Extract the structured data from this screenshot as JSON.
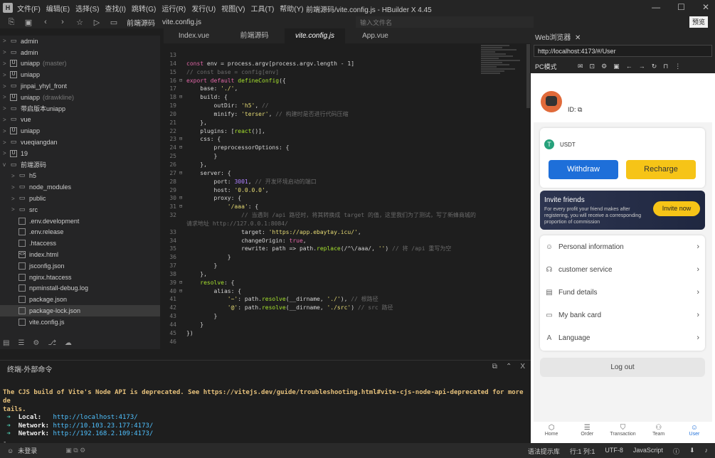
{
  "window": {
    "title": "前端源码/vite.config.js - HBuilder X 4.45",
    "menu": [
      "文件(F)",
      "编辑(E)",
      "选择(S)",
      "查找(I)",
      "跳转(G)",
      "运行(R)",
      "发行(U)",
      "视图(V)",
      "工具(T)",
      "帮助(Y)"
    ],
    "controls": [
      "—",
      "☐",
      "✕"
    ]
  },
  "toolbar": {
    "crumb1": "前端源码",
    "crumb2": "vite.config.js",
    "search_placeholder": "输入文件名",
    "preview_label": "预览"
  },
  "tree": [
    {
      "arrow": ">",
      "icon": "folder",
      "label": "admin",
      "branch": "",
      "indent": 0
    },
    {
      "arrow": ">",
      "icon": "folder",
      "label": "admin",
      "branch": "",
      "indent": 0
    },
    {
      "arrow": ">",
      "icon": "U",
      "label": "uniapp",
      "branch": "(master)",
      "indent": 0
    },
    {
      "arrow": ">",
      "icon": "U",
      "label": "uniapp",
      "branch": "",
      "indent": 0
    },
    {
      "arrow": ">",
      "icon": "folder",
      "label": "jinpai_yhyl_front",
      "branch": "",
      "indent": 0
    },
    {
      "arrow": ">",
      "icon": "U",
      "label": "uniapp",
      "branch": "(drawkline)",
      "indent": 0
    },
    {
      "arrow": ">",
      "icon": "folder",
      "label": "带启版本uniapp",
      "branch": "",
      "indent": 0
    },
    {
      "arrow": ">",
      "icon": "folder",
      "label": "vue",
      "branch": "",
      "indent": 0
    },
    {
      "arrow": ">",
      "icon": "U",
      "label": "uniapp",
      "branch": "",
      "indent": 0
    },
    {
      "arrow": ">",
      "icon": "folder",
      "label": "vueqiangdan",
      "branch": "",
      "indent": 0
    },
    {
      "arrow": ">",
      "icon": "U",
      "label": "19",
      "branch": "",
      "indent": 0
    },
    {
      "arrow": "v",
      "icon": "folder",
      "label": "前端源码",
      "branch": "",
      "indent": 0
    },
    {
      "arrow": ">",
      "icon": "folder",
      "label": "h5",
      "branch": "",
      "indent": 1
    },
    {
      "arrow": ">",
      "icon": "folder",
      "label": "node_modules",
      "branch": "",
      "indent": 1
    },
    {
      "arrow": ">",
      "icon": "folder",
      "label": "public",
      "branch": "",
      "indent": 1
    },
    {
      "arrow": ">",
      "icon": "folder",
      "label": "src",
      "branch": "",
      "indent": 1
    },
    {
      "arrow": "",
      "icon": "file",
      "label": ".env.development",
      "branch": "",
      "indent": 1
    },
    {
      "arrow": "",
      "icon": "file",
      "label": ".env.release",
      "branch": "",
      "indent": 1
    },
    {
      "arrow": "",
      "icon": "file",
      "label": ".htaccess",
      "branch": "",
      "indent": 1
    },
    {
      "arrow": "",
      "icon": "<>",
      "label": "index.html",
      "branch": "",
      "indent": 1
    },
    {
      "arrow": "",
      "icon": "file",
      "label": "jsconfig.json",
      "branch": "",
      "indent": 1
    },
    {
      "arrow": "",
      "icon": "file",
      "label": "nginx.htaccess",
      "branch": "",
      "indent": 1
    },
    {
      "arrow": "",
      "icon": "file",
      "label": "npminstall-debug.log",
      "branch": "",
      "indent": 1
    },
    {
      "arrow": "",
      "icon": "file",
      "label": "package.json",
      "branch": "",
      "indent": 1
    },
    {
      "arrow": "",
      "icon": "file",
      "label": "package-lock.json",
      "branch": "",
      "indent": 1,
      "selected": true
    },
    {
      "arrow": "",
      "icon": "file",
      "label": "vite.config.js",
      "branch": "",
      "indent": 1
    }
  ],
  "tabs": [
    "Index.vue",
    "前端源码",
    "vite.config.js",
    "App.vue"
  ],
  "code": [
    [
      "13",
      ""
    ],
    [
      "14",
      "const env = process.argv[process.argv.length - 1]"
    ],
    [
      "15",
      "// const base = config[env]"
    ],
    [
      "16",
      "export default defineConfig({"
    ],
    [
      "17",
      "    base: './',"
    ],
    [
      "18",
      "    build: {"
    ],
    [
      "19",
      "        outDir: 'h5', //"
    ],
    [
      "20",
      "        minify: 'terser', // 构建时是否进行代码压缩"
    ],
    [
      "21",
      "    },"
    ],
    [
      "22",
      "    plugins: [react()],"
    ],
    [
      "23",
      "    css: {"
    ],
    [
      "24",
      "        preprocessorOptions: {"
    ],
    [
      "25",
      "        }"
    ],
    [
      "26",
      "    },"
    ],
    [
      "27",
      "    server: {"
    ],
    [
      "28",
      "        port: 3001, // 开发环境启动的端口"
    ],
    [
      "29",
      "        host: '0.0.0.0',"
    ],
    [
      "30",
      "        proxy: {"
    ],
    [
      "31",
      "            '/aaa': {"
    ],
    [
      "32",
      "                // 当遇到 /api 路径时，将其转换成 target 的值，这里我们为了测试，写了新蜂商城的"
    ],
    [
      "",
      "请求地址 http://127.0.0.1:8084/"
    ],
    [
      "33",
      "                target: 'https://app.ebaytay.icu/',"
    ],
    [
      "34",
      "                changeOrigin: true,"
    ],
    [
      "35",
      "                rewrite: path => path.replace(/^\\/aaa/, '') // 将 /api 重写为空"
    ],
    [
      "36",
      "            }"
    ],
    [
      "37",
      "        }"
    ],
    [
      "38",
      "    },"
    ],
    [
      "39",
      "    resolve: {"
    ],
    [
      "40",
      "        alias: {"
    ],
    [
      "41",
      "            '~': path.resolve(__dirname, './'), // 根路径"
    ],
    [
      "42",
      "            '@': path.resolve(__dirname, './src') // src 路径"
    ],
    [
      "43",
      "        }"
    ],
    [
      "44",
      "    }"
    ],
    [
      "45",
      "})"
    ],
    [
      "46",
      ""
    ]
  ],
  "terminal": {
    "tab": "终端-外部命令",
    "warn1": "The CJS build of Vite's Node API is deprecated. See https://vitejs.dev/guide/troubleshooting.html#vite-cjs-node-api-deprecated for more de",
    "warn2": "tails.",
    "local_label": "Local:",
    "local_url": "http://localhost:4173/",
    "net1_label": "Network:",
    "net1_url": "http://10.103.23.177:4173/",
    "net2_label": "Network:",
    "net2_url": "http://192.168.2.109:4173/",
    "prompt": "-"
  },
  "statusbar": {
    "left": "未登录",
    "hint": "语法提示库",
    "pos": "行:1  列:1",
    "enc": "UTF-8",
    "lang": "JavaScript"
  },
  "browser": {
    "tab": "Web浏览器",
    "url": "http://localhost:4173/#/User",
    "mode": "PC模式"
  },
  "app": {
    "id_label": "ID:",
    "currency": "USDT",
    "withdraw": "Withdraw",
    "recharge": "Recharge",
    "invite_title": "Invite friends",
    "invite_desc": "For every profit your friend makes after registering, you will receive a corresponding proportion of commission",
    "invite_btn": "Invite now",
    "menu": [
      {
        "icon": "person-icon",
        "glyph": "☺",
        "label": "Personal information"
      },
      {
        "icon": "headset-icon",
        "glyph": "☊",
        "label": "customer service"
      },
      {
        "icon": "document-icon",
        "glyph": "▤",
        "label": "Fund details"
      },
      {
        "icon": "card-icon",
        "glyph": "▭",
        "label": "My bank card"
      },
      {
        "icon": "language-icon",
        "glyph": "A",
        "label": "Language"
      }
    ],
    "logout": "Log out",
    "nav": [
      {
        "icon": "home-icon",
        "glyph": "⬡",
        "label": "Home",
        "active": false
      },
      {
        "icon": "order-icon",
        "glyph": "☰",
        "label": "Order",
        "active": false
      },
      {
        "icon": "transaction-icon",
        "glyph": "⛉",
        "label": "Transaction",
        "active": false
      },
      {
        "icon": "team-icon",
        "glyph": "⚇",
        "label": "Team",
        "active": false
      },
      {
        "icon": "user-icon",
        "glyph": "☺",
        "label": "User",
        "active": true
      }
    ]
  }
}
